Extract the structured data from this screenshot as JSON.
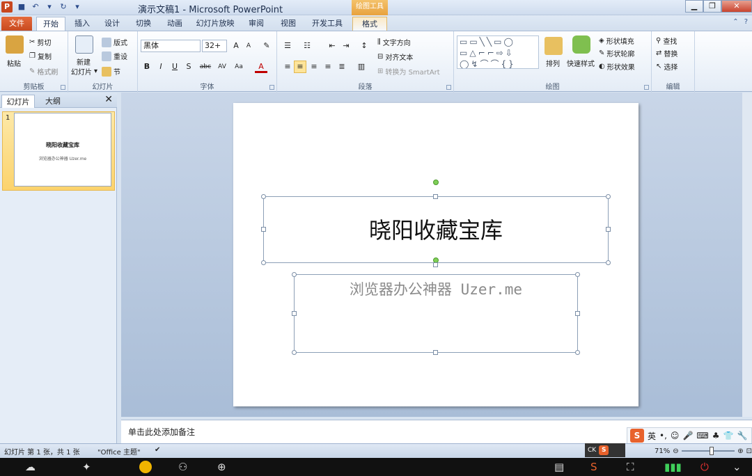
{
  "window": {
    "title": "演示文稿1 - Microsoft PowerPoint",
    "context_tab_title": "绘图工具"
  },
  "tabs": [
    "文件",
    "开始",
    "插入",
    "设计",
    "切换",
    "动画",
    "幻灯片放映",
    "审阅",
    "视图",
    "开发工具",
    "格式"
  ],
  "ribbon": {
    "clipboard": {
      "label": "剪贴板",
      "paste": "粘贴",
      "cut": "剪切",
      "copy": "复制",
      "format_painter": "格式刷"
    },
    "slides": {
      "label": "幻灯片",
      "new_slide": "新建",
      "new_slide_2": "幻灯片",
      "layout": "版式",
      "reset": "重设",
      "section": "节"
    },
    "font": {
      "label": "字体",
      "font_name": "黑体",
      "font_size": "32+"
    },
    "paragraph": {
      "label": "段落",
      "text_direction": "文字方向",
      "align_text": "对齐文本",
      "smartart": "转换为 SmartArt"
    },
    "drawing": {
      "label": "绘图",
      "arrange": "排列",
      "quick_styles": "快速样式",
      "shape_fill": "形状填充",
      "shape_outline": "形状轮廓",
      "shape_effects": "形状效果"
    },
    "editing": {
      "label": "编辑",
      "find": "查找",
      "replace": "替换",
      "select": "选择"
    }
  },
  "left_panel": {
    "tab_slides": "幻灯片",
    "tab_outline": "大纲",
    "slide_number": "1",
    "thumb_title": "晓阳收藏宝库",
    "thumb_subtitle": "浏览器办公神器 Uzer.me"
  },
  "slide": {
    "title": "晓阳收藏宝库",
    "subtitle": "浏览器办公神器 Uzer.me"
  },
  "notes": {
    "placeholder": "单击此处添加备注"
  },
  "status": {
    "slide_info": "幻灯片 第 1 张，共 1 张",
    "theme": "\"Office 主题\"",
    "zoom": "71%"
  },
  "ime": {
    "lang": "英",
    "ck": "CK"
  },
  "colors": {
    "file_tab": "#c84a1f",
    "accent": "#2a4a8a",
    "context": "#e8a23e"
  }
}
